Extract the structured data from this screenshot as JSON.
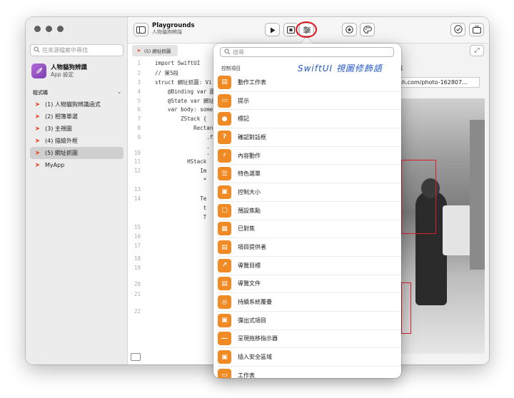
{
  "sidebar": {
    "search_placeholder": "在來源檔案中尋找",
    "app_name": "人物貓狗辨識",
    "app_subtitle": "App 設定",
    "section_title": "程式碼",
    "items": [
      {
        "label": "(1) 人物貓狗辨識函式"
      },
      {
        "label": "(2) 相簿單選"
      },
      {
        "label": "(3) 主視圖"
      },
      {
        "label": "(4) 描繪外框"
      },
      {
        "label": "(5) 網址抓圖"
      },
      {
        "label": "MyApp"
      }
    ]
  },
  "toolbar": {
    "title": "Playgrounds",
    "subtitle": "人物貓狗辨識"
  },
  "editor": {
    "tab_label": "(5) 網址抓圖",
    "lines": [
      {
        "num": "1",
        "text": "import SwiftUI"
      },
      {
        "num": "2",
        "text": "// 第5段"
      },
      {
        "num": "3",
        "text": "struct 網址抓圖: Vi"
      },
      {
        "num": "4",
        "text": "    @Binding var 圖"
      },
      {
        "num": "5",
        "text": "    @State var 網址"
      },
      {
        "num": "6",
        "text": "    var body: some"
      },
      {
        "num": "7",
        "text": "        ZStack {"
      },
      {
        "num": "8",
        "text": "            Rectan"
      },
      {
        "num": "9",
        "text": "                .f"
      },
      {
        "num": "",
        "text": "                ."
      },
      {
        "num": "10",
        "text": "                ."
      },
      {
        "num": "11",
        "text": "          HStack"
      },
      {
        "num": "12",
        "text": "              Im"
      },
      {
        "num": "",
        "text": "               *"
      },
      {
        "num": "13",
        "text": ""
      },
      {
        "num": "14",
        "text": "              Te"
      },
      {
        "num": "",
        "text": "               t"
      },
      {
        "num": "",
        "text": "               T"
      },
      {
        "num": "15",
        "text": ""
      },
      {
        "num": "16",
        "text": ""
      },
      {
        "num": "17",
        "text": ""
      },
      {
        "num": "18",
        "text": ""
      },
      {
        "num": "19",
        "text": ""
      },
      {
        "num": "20",
        "text": ""
      },
      {
        "num": "21",
        "text": ""
      },
      {
        "num": "22",
        "text": ""
      }
    ]
  },
  "preview": {
    "title_fragment": "辨識",
    "url_value": "ash.com/photo-162807..."
  },
  "popover": {
    "search_placeholder": "搜尋",
    "section_header": "控制項目",
    "annotation": "SwiftUI 視圖修飾語",
    "items": [
      {
        "label": "動作工作表",
        "icon": "action-sheet-icon"
      },
      {
        "label": "提示",
        "icon": "alert-icon"
      },
      {
        "label": "標記",
        "icon": "badge-icon"
      },
      {
        "label": "確認對話框",
        "icon": "confirmation-dialog-icon"
      },
      {
        "label": "內容動作",
        "icon": "content-action-icon"
      },
      {
        "label": "特色選單",
        "icon": "context-menu-icon"
      },
      {
        "label": "控制大小",
        "icon": "control-size-icon"
      },
      {
        "label": "預設焦點",
        "icon": "default-focus-icon"
      },
      {
        "label": "已對焦",
        "icon": "focused-icon"
      },
      {
        "label": "項目提供者",
        "icon": "item-provider-icon"
      },
      {
        "label": "導覽目標",
        "icon": "navigation-destination-icon"
      },
      {
        "label": "導覽文件",
        "icon": "navigation-document-icon"
      },
      {
        "label": "持續系統覆疊",
        "icon": "persistent-overlay-icon"
      },
      {
        "label": "彈出式項目",
        "icon": "popover-icon"
      },
      {
        "label": "呈現拖移指示器",
        "icon": "drag-indicator-icon"
      },
      {
        "label": "插入安全區域",
        "icon": "safe-area-icon"
      },
      {
        "label": "工作表",
        "icon": "sheet-icon"
      }
    ]
  },
  "colors": {
    "accent_orange": "#f08a25",
    "swift_orange": "#e8502f",
    "highlight_red": "#e4141b",
    "annotation_blue": "#2259c9"
  }
}
